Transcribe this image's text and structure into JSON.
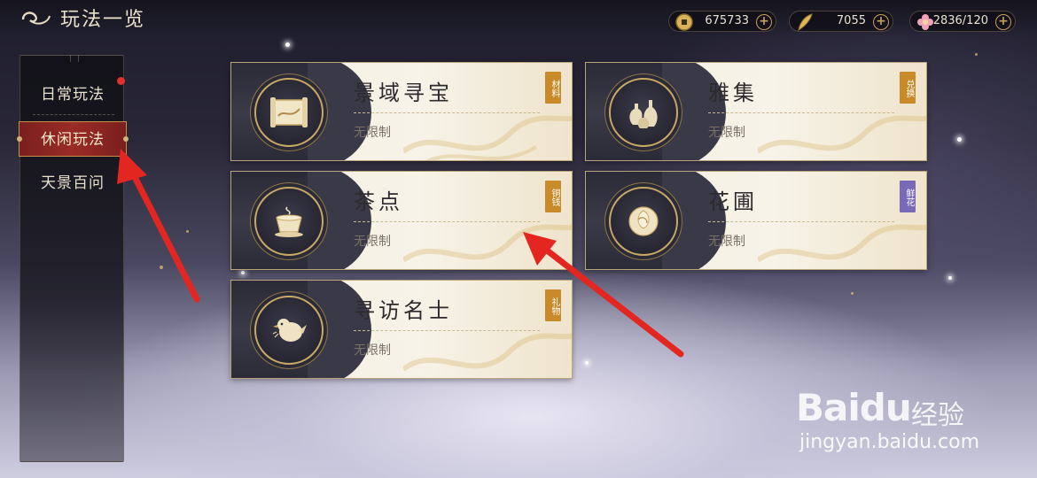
{
  "header": {
    "title": "玩法一览"
  },
  "resources": [
    {
      "icon": "coin-icon",
      "value": "675733"
    },
    {
      "icon": "feather-icon",
      "value": "7055"
    },
    {
      "icon": "flower-icon",
      "value": "2836/120"
    }
  ],
  "sidebar": {
    "items": [
      {
        "label": "日常玩法",
        "active": false
      },
      {
        "label": "休闲玩法",
        "active": true
      },
      {
        "label": "天景百问",
        "active": false
      }
    ]
  },
  "cards": [
    {
      "name": "景域寻宝",
      "sub": "无限制",
      "tag": "材料",
      "tag_color": "#c98a2a",
      "icon": "scroll-map-icon"
    },
    {
      "name": "雅集",
      "sub": "无限制",
      "tag": "兑换",
      "tag_color": "#c98a2a",
      "icon": "vases-icon"
    },
    {
      "name": "茶点",
      "sub": "无限制",
      "tag": "铜钱",
      "tag_color": "#c98a2a",
      "icon": "teacup-icon"
    },
    {
      "name": "花圃",
      "sub": "无限制",
      "tag": "鲜花",
      "tag_color": "#7a69b8",
      "icon": "rose-icon"
    },
    {
      "name": "寻访名士",
      "sub": "无限制",
      "tag": "礼物",
      "tag_color": "#c98a2a",
      "icon": "bird-icon"
    }
  ],
  "watermark": {
    "logo": "Baidu",
    "sub": "经验",
    "url": "jingyan.baidu.com"
  }
}
